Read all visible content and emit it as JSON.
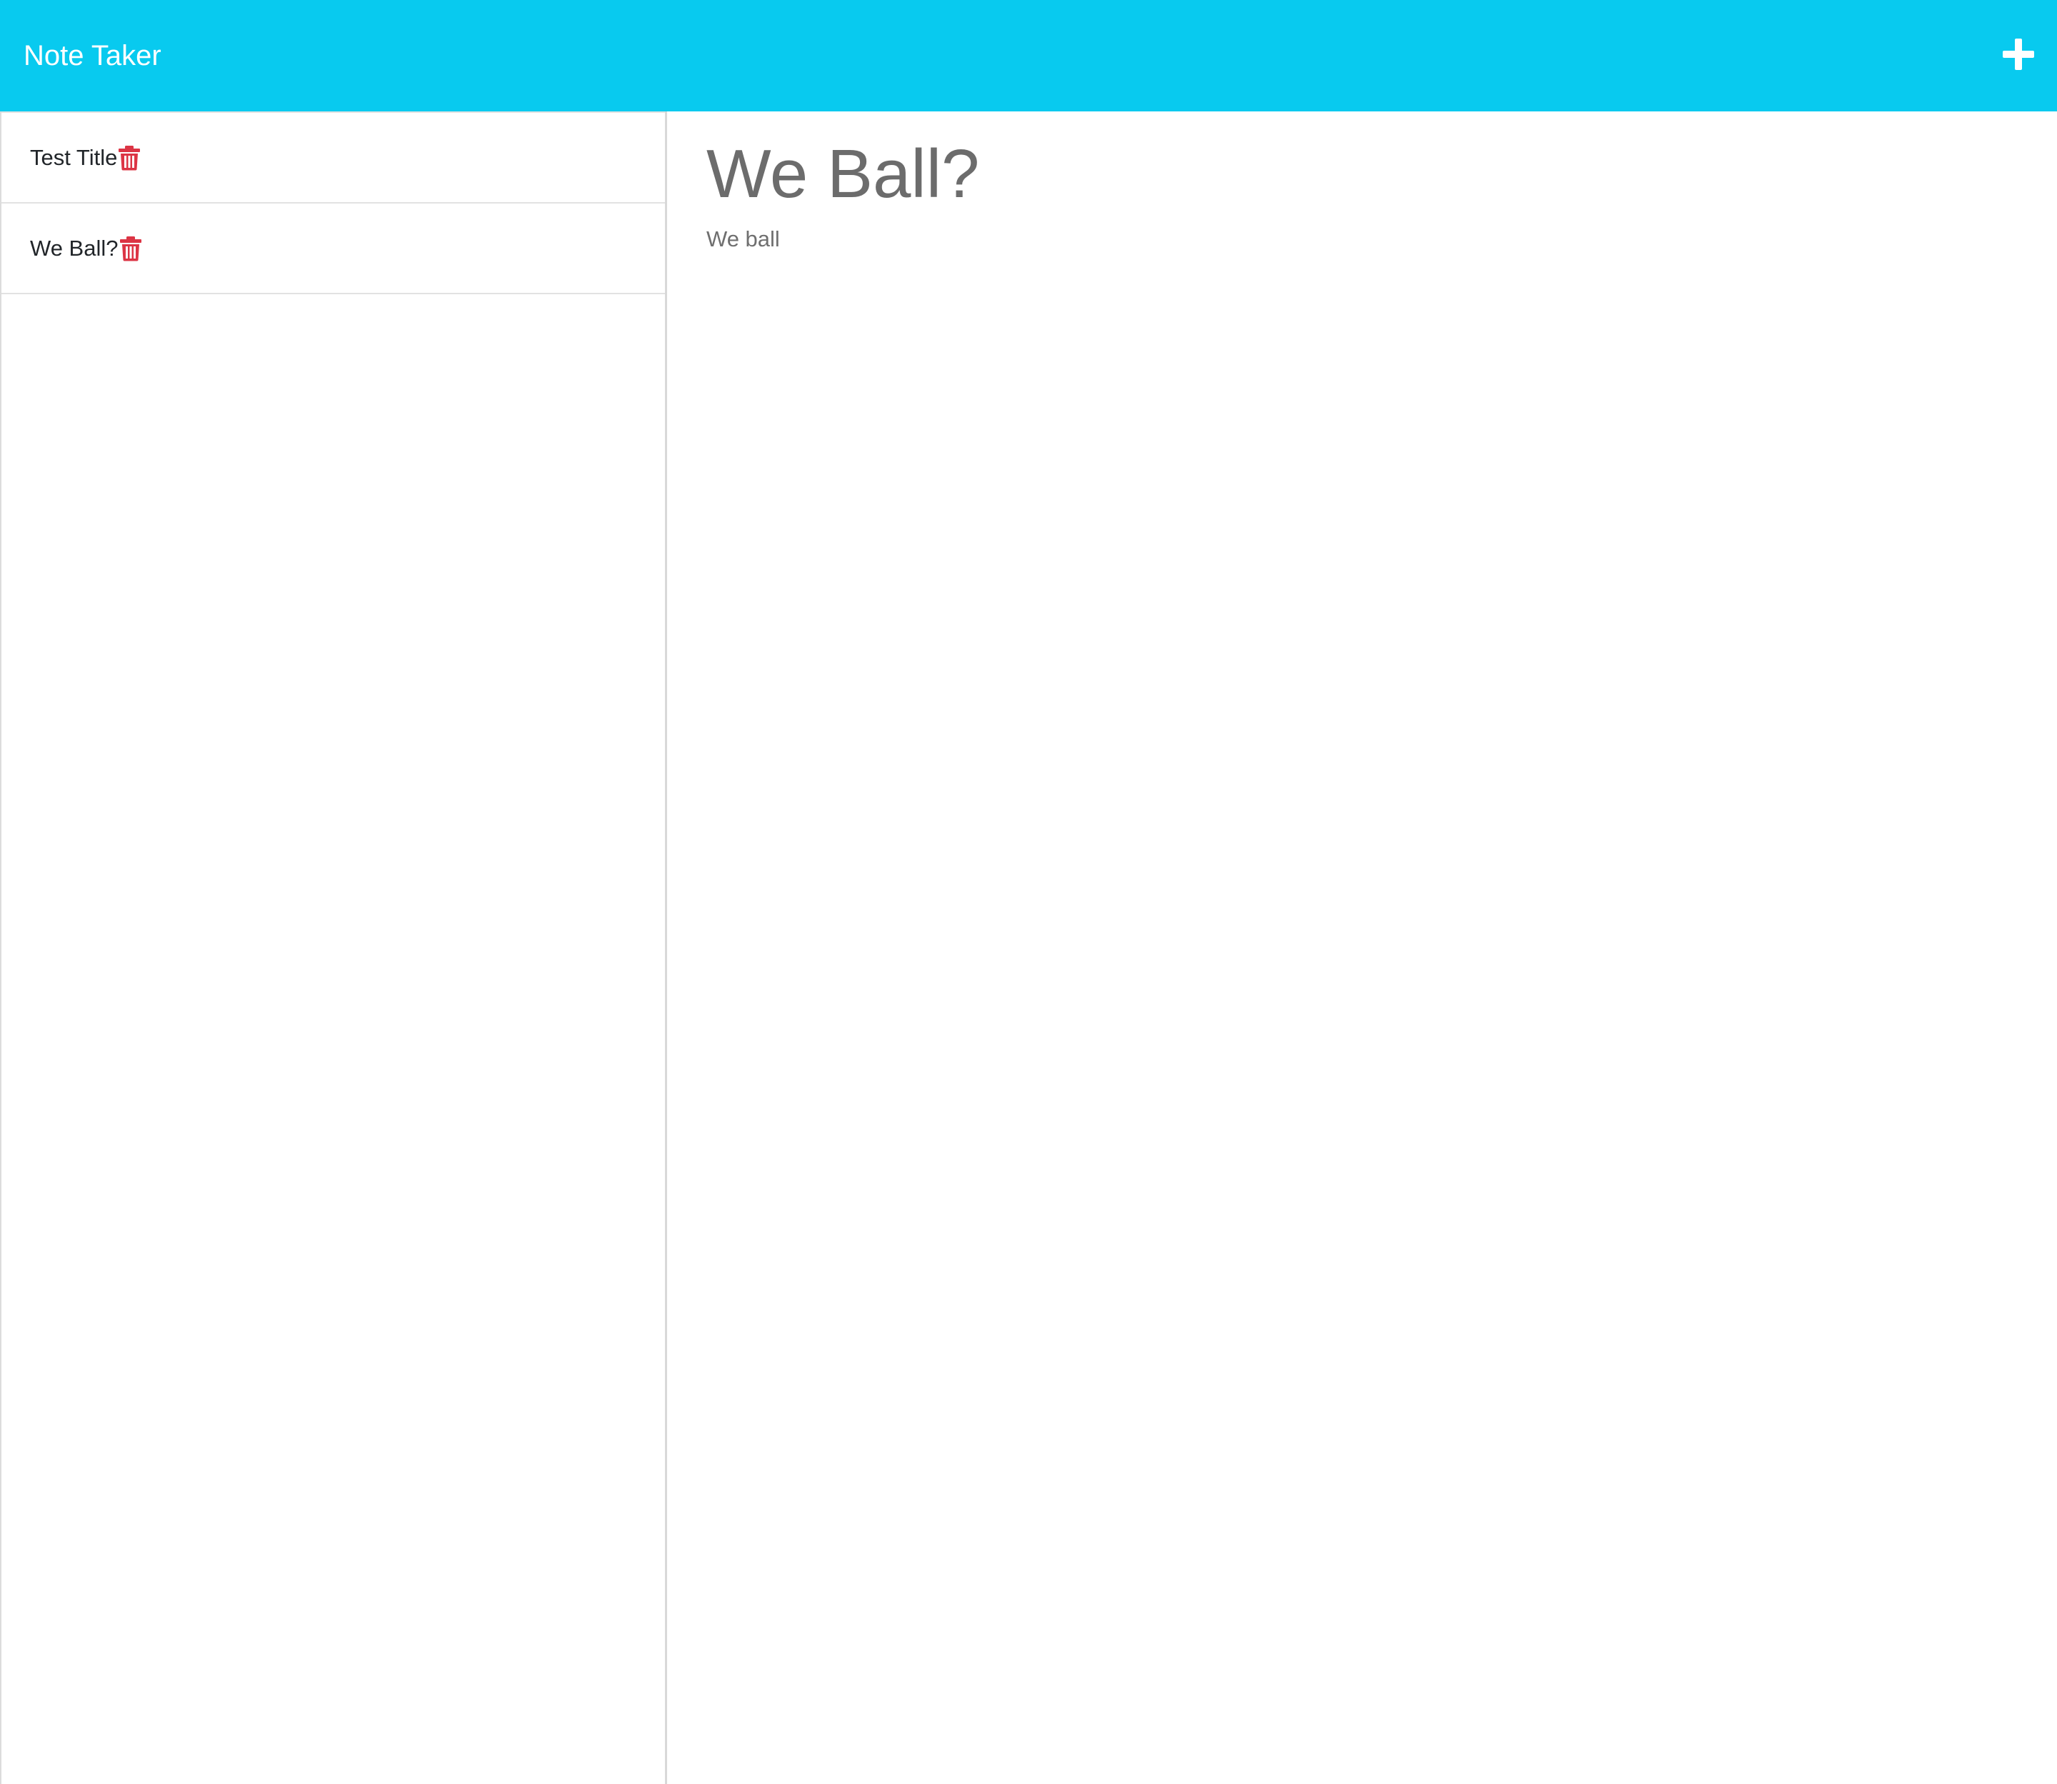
{
  "app": {
    "title": "Note Taker",
    "accent_color": "#08caef",
    "new_note_icon": "plus-icon"
  },
  "notes": [
    {
      "title": "Test Title",
      "delete_icon": "trash-icon"
    },
    {
      "title": "We Ball?",
      "delete_icon": "trash-icon"
    }
  ],
  "active_note": {
    "title": "We Ball?",
    "text": "We ball"
  },
  "colors": {
    "delete_icon": "#dc3545",
    "note_text": "#212529",
    "active_text": "#6c6c6c"
  }
}
